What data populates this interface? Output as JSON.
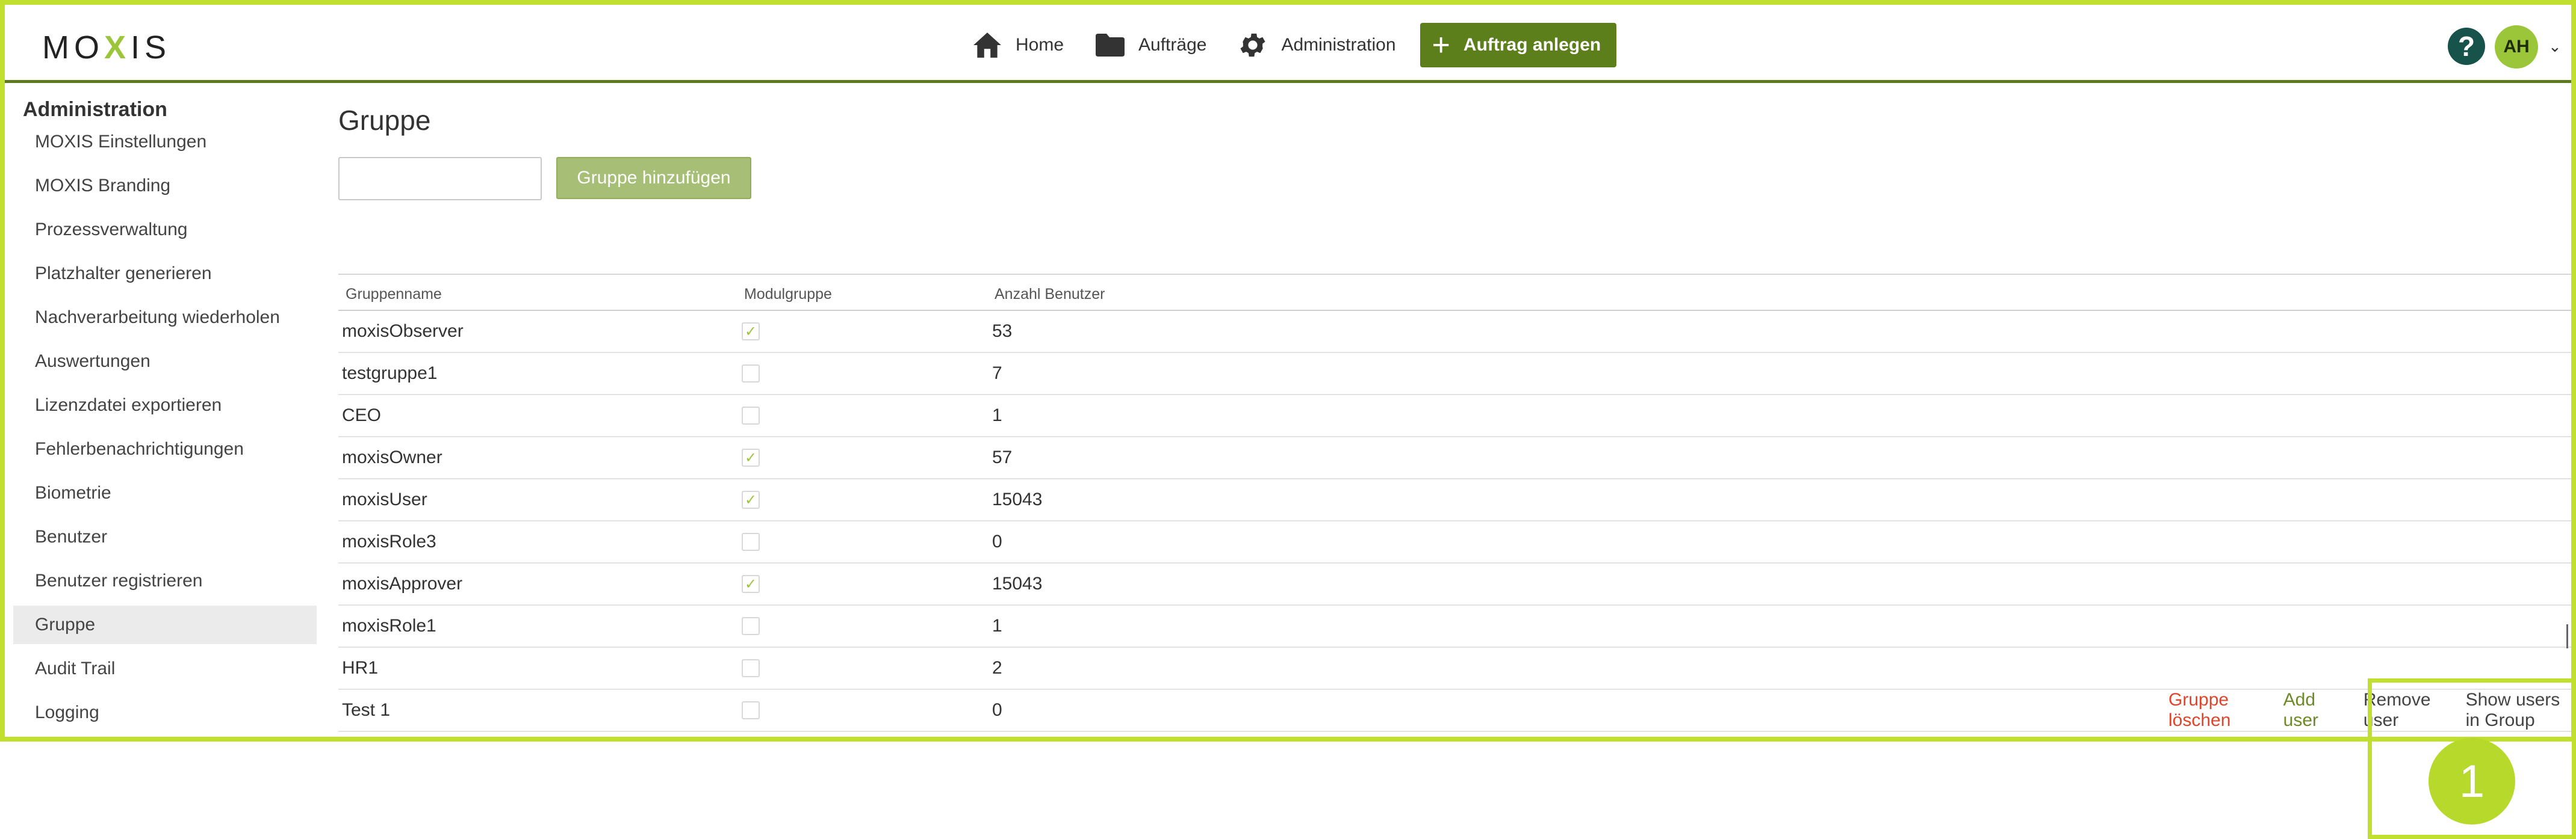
{
  "app": {
    "logo_left": "MO",
    "logo_x": "X",
    "logo_right": "IS"
  },
  "nav": {
    "items": [
      {
        "label": "Home",
        "icon": "home-icon"
      },
      {
        "label": "Aufträge",
        "icon": "folder-icon"
      },
      {
        "label": "Administration",
        "icon": "gear-icon"
      }
    ],
    "create_label": "Auftrag anlegen",
    "help": "?",
    "avatar": "AH",
    "caret": "⌄"
  },
  "sidebar": {
    "title": "Administration",
    "items": [
      {
        "label": "MOXIS Einstellungen"
      },
      {
        "label": "MOXIS Branding"
      },
      {
        "label": "Prozessverwaltung"
      },
      {
        "label": "Platzhalter generieren"
      },
      {
        "label": "Nachverarbeitung wiederholen"
      },
      {
        "label": "Auswertungen"
      },
      {
        "label": "Lizenzdatei exportieren"
      },
      {
        "label": "Fehlerbenachrichtigungen"
      },
      {
        "label": "Biometrie"
      },
      {
        "label": "Benutzer"
      },
      {
        "label": "Benutzer registrieren"
      },
      {
        "label": "Gruppe",
        "active": true
      },
      {
        "label": "Audit Trail"
      },
      {
        "label": "Logging"
      }
    ]
  },
  "main": {
    "title": "Gruppe",
    "input_value": "",
    "add_button": "Gruppe hinzufügen",
    "table": {
      "headers": [
        "Gruppenname",
        "Modulgruppe",
        "Anzahl Benutzer"
      ],
      "rows": [
        {
          "name": "moxisObserver",
          "module": true,
          "count": "53"
        },
        {
          "name": "testgruppe1",
          "module": false,
          "count": "7"
        },
        {
          "name": "CEO",
          "module": false,
          "count": "1"
        },
        {
          "name": "moxisOwner",
          "module": true,
          "count": "57"
        },
        {
          "name": "moxisUser",
          "module": true,
          "count": "15043"
        },
        {
          "name": "moxisRole3",
          "module": false,
          "count": "0"
        },
        {
          "name": "moxisApprover",
          "module": true,
          "count": "15043"
        },
        {
          "name": "moxisRole1",
          "module": false,
          "count": "1"
        },
        {
          "name": "HR1",
          "module": false,
          "count": "2"
        },
        {
          "name": "Test 1",
          "module": false,
          "count": "0"
        }
      ]
    },
    "row_actions": {
      "delete": "Gruppe löschen",
      "add_user": "Add user",
      "remove_user": "Remove user",
      "show_users": "Show users in Group"
    }
  },
  "annotation": {
    "label": "1"
  },
  "colors": {
    "highlight": "#c1df2f",
    "primary": "#5c7f1c",
    "danger": "#e0452c",
    "help": "#17524b",
    "avatar": "#9cc63a"
  }
}
